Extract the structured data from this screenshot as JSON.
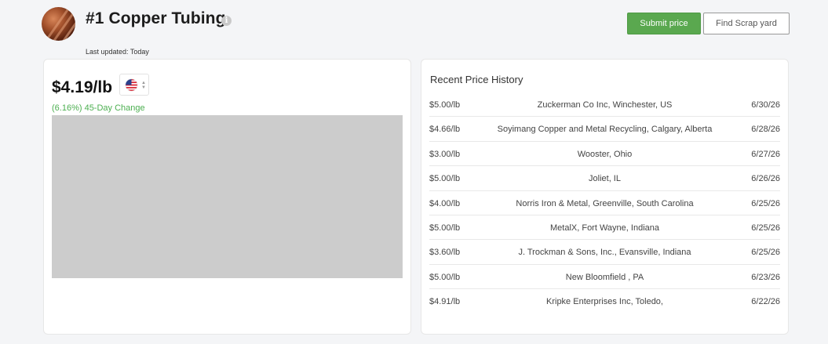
{
  "header": {
    "title": "#1 Copper Tubing",
    "last_updated": "Last updated: Today",
    "submit_label": "Submit price",
    "find_label": "Find Scrap yard"
  },
  "price_card": {
    "price": "$4.19/lb",
    "change": "(6.16%) 45-Day Change",
    "country_flag": "us-flag-icon"
  },
  "history": {
    "title": "Recent Price History",
    "rows": [
      {
        "price": "$5.00/lb",
        "location": "Zuckerman Co Inc, Winchester, US",
        "date": "6/30/26"
      },
      {
        "price": "$4.66/lb",
        "location": "Soyimang Copper and Metal Recycling, Calgary, Alberta",
        "date": "6/28/26"
      },
      {
        "price": "$3.00/lb",
        "location": "Wooster, Ohio",
        "date": "6/27/26"
      },
      {
        "price": "$5.00/lb",
        "location": "Joliet, IL",
        "date": "6/26/26"
      },
      {
        "price": "$4.00/lb",
        "location": "Norris Iron & Metal, Greenville, South Carolina",
        "date": "6/25/26"
      },
      {
        "price": "$5.00/lb",
        "location": "MetalX, Fort Wayne, Indiana",
        "date": "6/25/26"
      },
      {
        "price": "$3.60/lb",
        "location": "J. Trockman & Sons, Inc., Evansville, Indiana",
        "date": "6/25/26"
      },
      {
        "price": "$5.00/lb",
        "location": "New Bloomfield , PA",
        "date": "6/23/26"
      },
      {
        "price": "$4.91/lb",
        "location": "Kripke Enterprises Inc, Toledo,",
        "date": "6/22/26"
      }
    ]
  },
  "colors": {
    "accent_green": "#5aa84f",
    "change_green": "#4caf50",
    "chart_placeholder": "#cccccc"
  }
}
